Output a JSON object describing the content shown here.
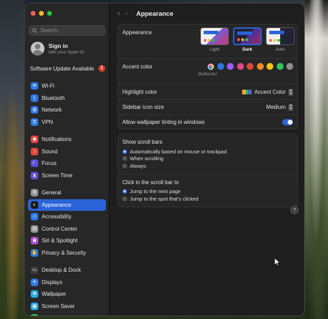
{
  "window": {
    "title": "Appearance"
  },
  "sidebar": {
    "search_placeholder": "Search",
    "account": {
      "name": "Sign in",
      "subtitle": "with your Apple ID"
    },
    "update": {
      "label": "Software Update Available",
      "count": "1"
    },
    "groups": [
      [
        {
          "label": "Wi-Fi",
          "icon": "wifi-icon",
          "color": "#2b78e4"
        },
        {
          "label": "Bluetooth",
          "icon": "bluetooth-icon",
          "color": "#2b78e4"
        },
        {
          "label": "Network",
          "icon": "network-icon",
          "color": "#2b78e4"
        },
        {
          "label": "VPN",
          "icon": "vpn-icon",
          "color": "#2b78e4"
        }
      ],
      [
        {
          "label": "Notifications",
          "icon": "notifications-icon",
          "color": "#e0463b"
        },
        {
          "label": "Sound",
          "icon": "sound-icon",
          "color": "#e0463b"
        },
        {
          "label": "Focus",
          "icon": "focus-icon",
          "color": "#5b4fd6"
        },
        {
          "label": "Screen Time",
          "icon": "screen-time-icon",
          "color": "#5b4fd6"
        }
      ],
      [
        {
          "label": "General",
          "icon": "gear-icon",
          "color": "#8e8e93"
        },
        {
          "label": "Appearance",
          "icon": "appearance-icon",
          "color": "#1c1c1c",
          "active": true
        },
        {
          "label": "Accessibility",
          "icon": "accessibility-icon",
          "color": "#2b78e4"
        },
        {
          "label": "Control Center",
          "icon": "control-center-icon",
          "color": "#8e8e93"
        },
        {
          "label": "Siri & Spotlight",
          "icon": "siri-icon",
          "color": "#b04ad6"
        },
        {
          "label": "Privacy & Security",
          "icon": "hand-icon",
          "color": "#2b78e4"
        }
      ],
      [
        {
          "label": "Desktop & Dock",
          "icon": "dock-icon",
          "color": "#3a3a3c"
        },
        {
          "label": "Displays",
          "icon": "displays-icon",
          "color": "#2b78e4"
        },
        {
          "label": "Wallpaper",
          "icon": "wallpaper-icon",
          "color": "#2ba7e4"
        },
        {
          "label": "Screen Saver",
          "icon": "screen-saver-icon",
          "color": "#2ba7e4"
        },
        {
          "label": "Battery",
          "icon": "battery-icon",
          "color": "#34c759"
        }
      ]
    ]
  },
  "appearance": {
    "label": "Appearance",
    "options": [
      {
        "caption": "Light",
        "selected": false
      },
      {
        "caption": "Dark",
        "selected": true
      },
      {
        "caption": "Auto",
        "selected": false
      }
    ],
    "accent_label": "Accent color",
    "accent_caption": "Multicolor",
    "accent_colors": [
      "multicolor",
      "#2b78e4",
      "#a05cff",
      "#e0468a",
      "#e0463b",
      "#f08a24",
      "#f5c518",
      "#34c759",
      "#8e8e93"
    ],
    "highlight_label": "Highlight color",
    "highlight_value": "Accent Color",
    "sidebar_icon_label": "Sidebar icon size",
    "sidebar_icon_value": "Medium",
    "tinting_label": "Allow wallpaper tinting in windows",
    "tinting_on": true
  },
  "scroll": {
    "show_label": "Show scroll bars",
    "show_options": [
      {
        "label": "Automatically based on mouse or trackpad",
        "selected": true
      },
      {
        "label": "When scrolling",
        "selected": false
      },
      {
        "label": "Always",
        "selected": false
      }
    ],
    "click_label": "Click in the scroll bar to",
    "click_options": [
      {
        "label": "Jump to the next page",
        "selected": true
      },
      {
        "label": "Jump to the spot that’s clicked",
        "selected": false
      }
    ]
  },
  "help_label": "?"
}
